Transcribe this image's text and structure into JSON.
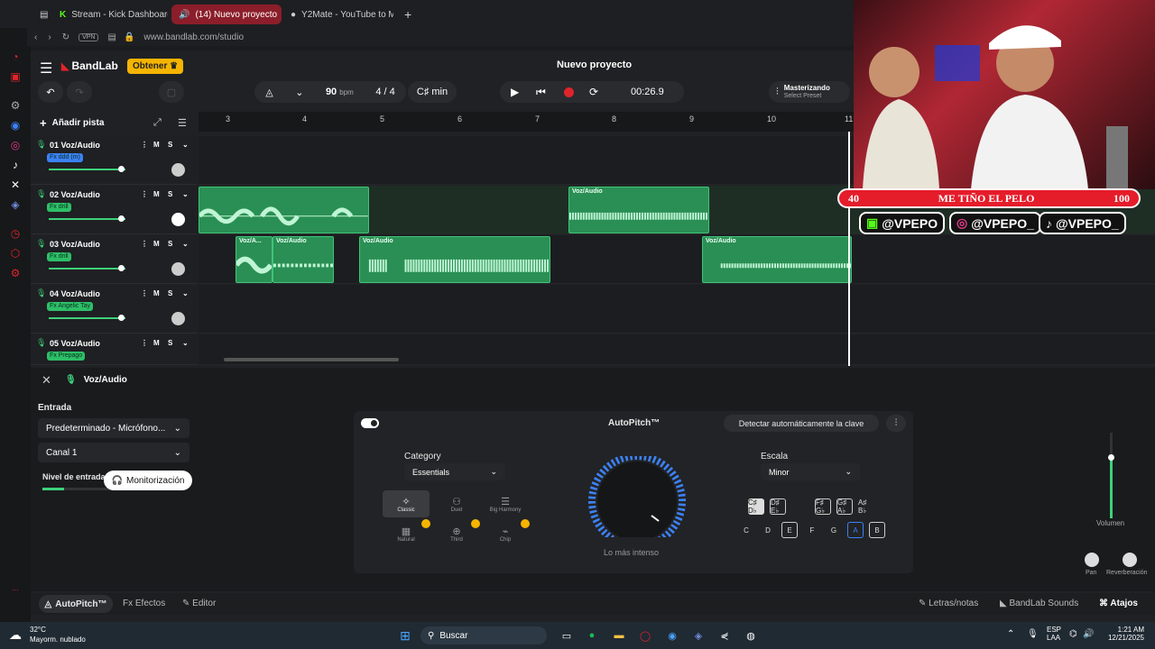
{
  "browser": {
    "tabs": [
      {
        "label": "Stream - Kick Dashboard"
      },
      {
        "label": "(14) Nuevo proyecto"
      },
      {
        "label": "Y2Mate - YouTube to MP"
      }
    ],
    "url": "www.bandlab.com/studio",
    "vpn": "VPN"
  },
  "header": {
    "brand": "BandLab",
    "obtener": "Obtener",
    "project_title": "Nuevo proyecto",
    "bpm_value": "90",
    "bpm_unit": "bpm",
    "time_sig": "4 / 4",
    "key": "C♯ min",
    "time": "00:26.9",
    "mastering_title": "Masterizando",
    "mastering_sub": "Select Preset"
  },
  "toolbar": {
    "add_track": "Añadir pista"
  },
  "ruler": {
    "ticks": [
      "3",
      "4",
      "5",
      "6",
      "7",
      "8",
      "9",
      "10",
      "11"
    ]
  },
  "tracks": [
    {
      "num": "01",
      "name": "Voz/Audio",
      "fx": "Fx ddd (m)",
      "fx_color": "#3b82f6",
      "volume": 0.7
    },
    {
      "num": "02",
      "name": "Voz/Audio",
      "fx": "Fx drill",
      "fx_color": "#2dbf68",
      "volume": 0.7
    },
    {
      "num": "03",
      "name": "Voz/Audio",
      "fx": "Fx drill",
      "fx_color": "#2dbf68",
      "volume": 0.7
    },
    {
      "num": "04",
      "name": "Voz/Audio",
      "fx": "Fx Angelic Tay",
      "fx_color": "#2dbf68",
      "volume": 0.7
    },
    {
      "num": "05",
      "name": "Voz/Audio",
      "fx": "Fx Prepago",
      "fx_color": "#2dbf68",
      "volume": 0.7
    }
  ],
  "clip_labels": {
    "a": "Voz/Audio",
    "b": "Voz/A..."
  },
  "panel": {
    "track_name": "Voz/Audio",
    "entrada_label": "Entrada",
    "input_device": "Predeterminado - Micrófono...",
    "channel": "Canal 1",
    "nivel_label": "Nivel de entrada",
    "monitor_label": "Monitorización",
    "autopitch_title": "AutoPitch™",
    "detect_key": "Detectar automáticamente la clave",
    "category_label": "Category",
    "category_value": "Essentials",
    "presets": [
      "Classic",
      "Duet",
      "Big Harmony",
      "Natural",
      "Third",
      "Chip"
    ],
    "knob_label": "Lo más intenso",
    "escala_label": "Escala",
    "escala_value": "Minor",
    "sharp_keys": [
      "C♯ D♭",
      "D♯ E♭",
      "F♯ G♭",
      "G♯ A♭",
      "A♯ B♭"
    ],
    "natural_keys": [
      "C",
      "D",
      "E",
      "F",
      "G",
      "A",
      "B"
    ],
    "volumen": "Volumen",
    "pan": "Pan",
    "reverb": "Reverberación"
  },
  "overlay": {
    "bar_left": "40",
    "bar_text": "ME TIÑO EL PELO",
    "bar_right": "100",
    "handle": "@VPEPO",
    "handle2": "@VPEPO_",
    "handle3": "@VPEPO_"
  },
  "bottombar": {
    "autopitch": "AutoPitch™",
    "efectos": "Efectos",
    "editor": "Editor",
    "letras": "Letras/notas",
    "sounds": "BandLab Sounds",
    "atajos": "Atajos"
  },
  "taskbar": {
    "weather_temp": "32°C",
    "weather_desc": "Mayorm. nublado",
    "search": "Buscar",
    "lang1": "ESP",
    "lang2": "LAA",
    "clock_time": "1:21 AM",
    "clock_date": "12/21/2025"
  }
}
